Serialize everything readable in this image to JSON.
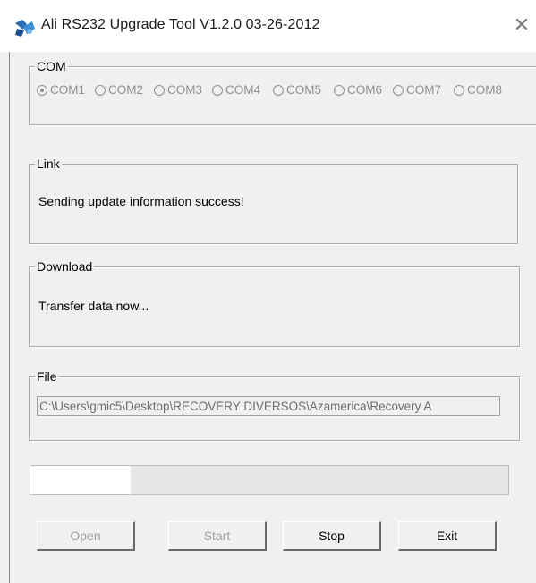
{
  "window": {
    "title": "Ali RS232 Upgrade Tool   V1.2.0  03-26-2012",
    "close_glyph": "✕"
  },
  "com": {
    "legend": "COM",
    "ports": [
      {
        "label": "COM1",
        "checked": true
      },
      {
        "label": "COM2",
        "checked": false
      },
      {
        "label": "COM3",
        "checked": false
      },
      {
        "label": "COM4",
        "checked": false
      },
      {
        "label": "COM5",
        "checked": false
      },
      {
        "label": "COM6",
        "checked": false
      },
      {
        "label": "COM7",
        "checked": false
      },
      {
        "label": "COM8",
        "checked": false
      }
    ]
  },
  "link": {
    "legend": "Link",
    "message": "Sending update information success!"
  },
  "download": {
    "legend": "Download",
    "message": "Transfer data now..."
  },
  "file": {
    "legend": "File",
    "path": "C:\\Users\\gmic5\\Desktop\\RECOVERY DIVERSOS\\Azamerica\\Recovery A"
  },
  "progress": {
    "value": 0.21
  },
  "buttons": {
    "open": "Open",
    "start": "Start",
    "stop": "Stop",
    "exit": "Exit"
  },
  "colors": {
    "window_bg": "#f0f0f0",
    "disabled_text": "#a0a0a0"
  }
}
